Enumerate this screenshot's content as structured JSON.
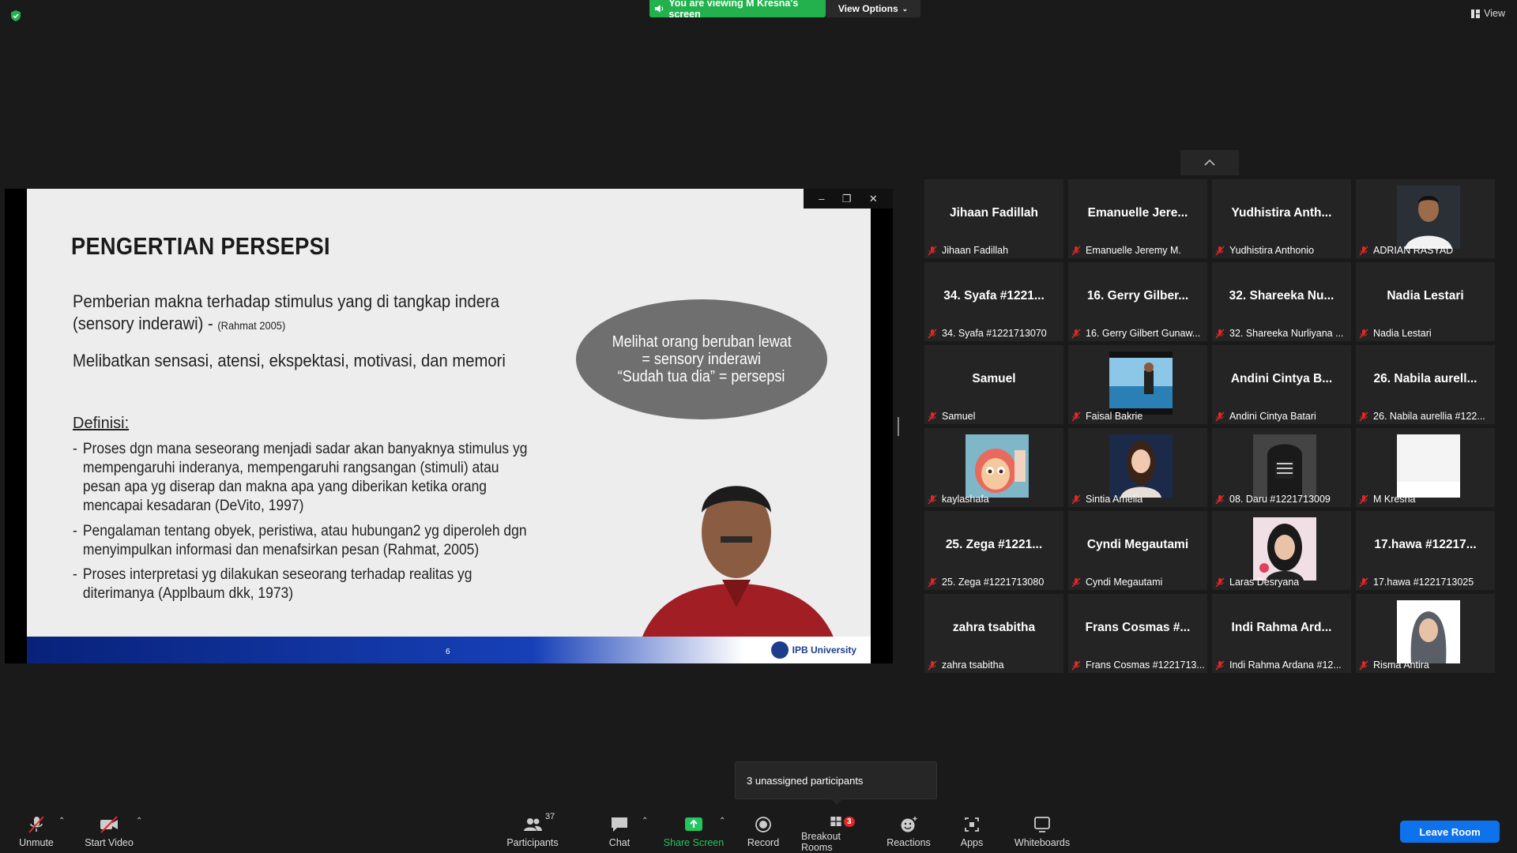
{
  "banner": {
    "viewing_text": "You are viewing M Kresna's screen",
    "view_options": "View Options"
  },
  "top_right": {
    "view_label": "View"
  },
  "slide": {
    "title": "PENGERTIAN PERSEPSI",
    "line1": "Pemberian makna terhadap stimulus yang di tangkap indera",
    "line2": "(sensory inderawi) -",
    "line2_cite": "(Rahmat 2005)",
    "line3": "Melibatkan sensasi, atensi, ekspektasi, motivasi, dan memori",
    "definisi": "Definisi:",
    "bullets": [
      "Proses dgn mana seseorang menjadi sadar akan banyaknya stimulus yg mempengaruhi inderanya, mempengaruhi rangsangan (stimuli) atau pesan apa yg diserap dan makna apa yang diberikan ketika orang mencapai kesadaran (DeVito, 1997)",
      "Pengalaman tentang obyek, peristiwa, atau hubungan2 yg diperoleh dgn menyimpulkan informasi dan menafsirkan pesan (Rahmat, 2005)",
      "Proses interpretasi yg dilakukan seseorang terhadap realitas yg diterimanya (Applbaum dkk, 1973)"
    ],
    "ellipse_lines": [
      "Melihat orang beruban lewat",
      "= sensory inderawi",
      "“Sudah tua dia” = persepsi"
    ],
    "page_number": "6",
    "logo_text": "IPB University"
  },
  "gallery": {
    "tiles": [
      {
        "big": "Jihaan Fadillah",
        "label": "Jihaan Fadillah"
      },
      {
        "big": "Emanuelle Jere...",
        "label": "Emanuelle Jeremy M."
      },
      {
        "big": "Yudhistira Anth...",
        "label": "Yudhistira Anthonio"
      },
      {
        "big": "",
        "label": "ADRIAN RASYAD",
        "photo": "man-white-shirt"
      },
      {
        "big": "34. Syafa #1221...",
        "label": "34. Syafa #1221713070"
      },
      {
        "big": "16. Gerry Gilber...",
        "label": "16. Gerry Gilbert Gunaw..."
      },
      {
        "big": "32. Shareeka Nu...",
        "label": "32. Shareeka Nurliyana ..."
      },
      {
        "big": "Nadia Lestari",
        "label": "Nadia Lestari"
      },
      {
        "big": "Samuel",
        "label": "Samuel"
      },
      {
        "big": "",
        "label": "Faisal Bakrie",
        "photo": "beach"
      },
      {
        "big": "Andini Cintya B...",
        "label": "Andini Cintya Batari"
      },
      {
        "big": "26. Nabila aurell...",
        "label": "26. Nabila aurellia #122..."
      },
      {
        "big": "",
        "label": "kaylashafa",
        "photo": "cartoon"
      },
      {
        "big": "",
        "label": "Sintia Amelia",
        "photo": "woman"
      },
      {
        "big": "",
        "label": "08. Daru #1221713009",
        "photo": "hoodie"
      },
      {
        "big": "",
        "label": "M Kresna",
        "photo": "white"
      },
      {
        "big": "25. Zega #1221...",
        "label": "25. Zega #1221713080"
      },
      {
        "big": "Cyndi Megautami",
        "label": "Cyndi Megautami"
      },
      {
        "big": "",
        "label": "Laras Desryana",
        "photo": "woman2"
      },
      {
        "big": "17.hawa #12217...",
        "label": "17.hawa #1221713025"
      },
      {
        "big": "zahra tsabitha",
        "label": "zahra tsabitha"
      },
      {
        "big": "Frans Cosmas #...",
        "label": "Frans Cosmas #1221713..."
      },
      {
        "big": "Indi Rahma Ard...",
        "label": "Indi Rahma Ardana #12..."
      },
      {
        "big": "",
        "label": "Risma Antira",
        "photo": "hijab"
      }
    ]
  },
  "tooltip": {
    "text": "3 unassigned participants"
  },
  "toolbar": {
    "unmute": "Unmute",
    "start_video": "Start Video",
    "participants": "Participants",
    "participants_count": "37",
    "chat": "Chat",
    "share_screen": "Share Screen",
    "record": "Record",
    "breakout_rooms": "Breakout Rooms",
    "breakout_badge": "3",
    "reactions": "Reactions",
    "apps": "Apps",
    "whiteboards": "Whiteboards",
    "leave_room": "Leave Room"
  },
  "colors": {
    "banner_green": "#22b14c",
    "leave_blue": "#0e72ed",
    "muted_red": "#e02828",
    "share_green": "#22c55e"
  }
}
